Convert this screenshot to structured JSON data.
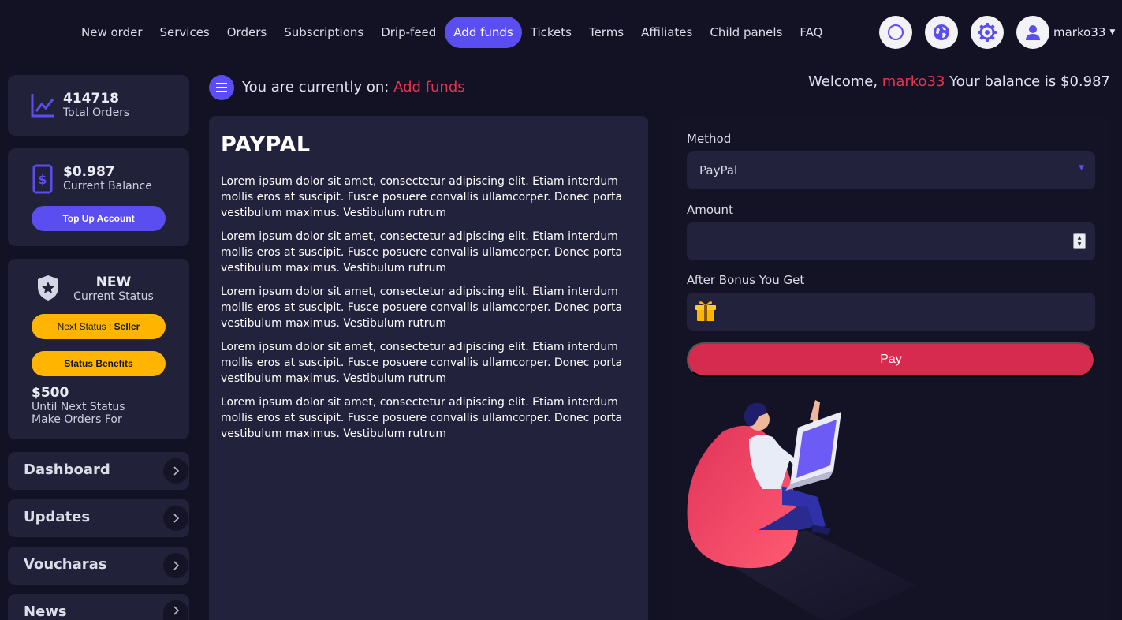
{
  "nav": {
    "items": [
      {
        "label": "New order",
        "active": false
      },
      {
        "label": "Services",
        "active": false
      },
      {
        "label": "Orders",
        "active": false
      },
      {
        "label": "Subscriptions",
        "active": false
      },
      {
        "label": "Drip-feed",
        "active": false
      },
      {
        "label": "Add funds",
        "active": true
      },
      {
        "label": "Tickets",
        "active": false
      },
      {
        "label": "Terms",
        "active": false
      },
      {
        "label": "Affiliates",
        "active": false
      },
      {
        "label": "Child panels",
        "active": false
      },
      {
        "label": "FAQ",
        "active": false
      }
    ],
    "icons": [
      "theme-circle-icon",
      "globe-icon",
      "gear-icon"
    ],
    "username": "marko33"
  },
  "sidebar": {
    "orders": {
      "value": "414718",
      "label": "Total Orders"
    },
    "balance": {
      "value": "$0.987",
      "label": "Current Balance",
      "button": "Top Up Account"
    },
    "status": {
      "name": "NEW",
      "label": "Current Status",
      "next_prefix": "Next Status : ",
      "next_value": "Seller",
      "benefits_button": "Status Benefits",
      "amount": "$500",
      "line1": "Until Next Status",
      "line2": "Make Orders For"
    },
    "menu": [
      "Dashboard",
      "Updates",
      "Voucharas",
      "News"
    ]
  },
  "breadcrumb": {
    "prefix": "You are currently on: ",
    "current": "Add funds"
  },
  "welcome": {
    "prefix": "Welcome, ",
    "username": "marko33",
    "suffix": " Your balance is $0.987"
  },
  "info": {
    "title": "PAYPAL",
    "paragraphs": [
      "Lorem ipsum dolor sit amet, consectetur adipiscing elit. Etiam interdum mollis eros at suscipit. Fusce posuere convallis ullamcorper. Donec porta vestibulum maximus. Vestibulum rutrum",
      "Lorem ipsum dolor sit amet, consectetur adipiscing elit. Etiam interdum mollis eros at suscipit. Fusce posuere convallis ullamcorper. Donec porta vestibulum maximus. Vestibulum rutrum",
      "Lorem ipsum dolor sit amet, consectetur adipiscing elit. Etiam interdum mollis eros at suscipit. Fusce posuere convallis ullamcorper. Donec porta vestibulum maximus. Vestibulum rutrum",
      "Lorem ipsum dolor sit amet, consectetur adipiscing elit. Etiam interdum mollis eros at suscipit. Fusce posuere convallis ullamcorper. Donec porta vestibulum maximus. Vestibulum rutrum",
      "Lorem ipsum dolor sit amet, consectetur adipiscing elit. Etiam interdum mollis eros at suscipit. Fusce posuere convallis ullamcorper. Donec porta vestibulum maximus. Vestibulum rutrum"
    ]
  },
  "form": {
    "method_label": "Method",
    "method_value": "PayPal",
    "amount_label": "Amount",
    "amount_value": "",
    "bonus_label": "After Bonus You Get",
    "bonus_value": "",
    "pay_button": "Pay"
  },
  "colors": {
    "background": "#131225",
    "card": "#22213a",
    "accent": "#5b4ef0",
    "highlight": "#e6344f",
    "pay": "#d62a4e",
    "status": "#ffb400"
  }
}
